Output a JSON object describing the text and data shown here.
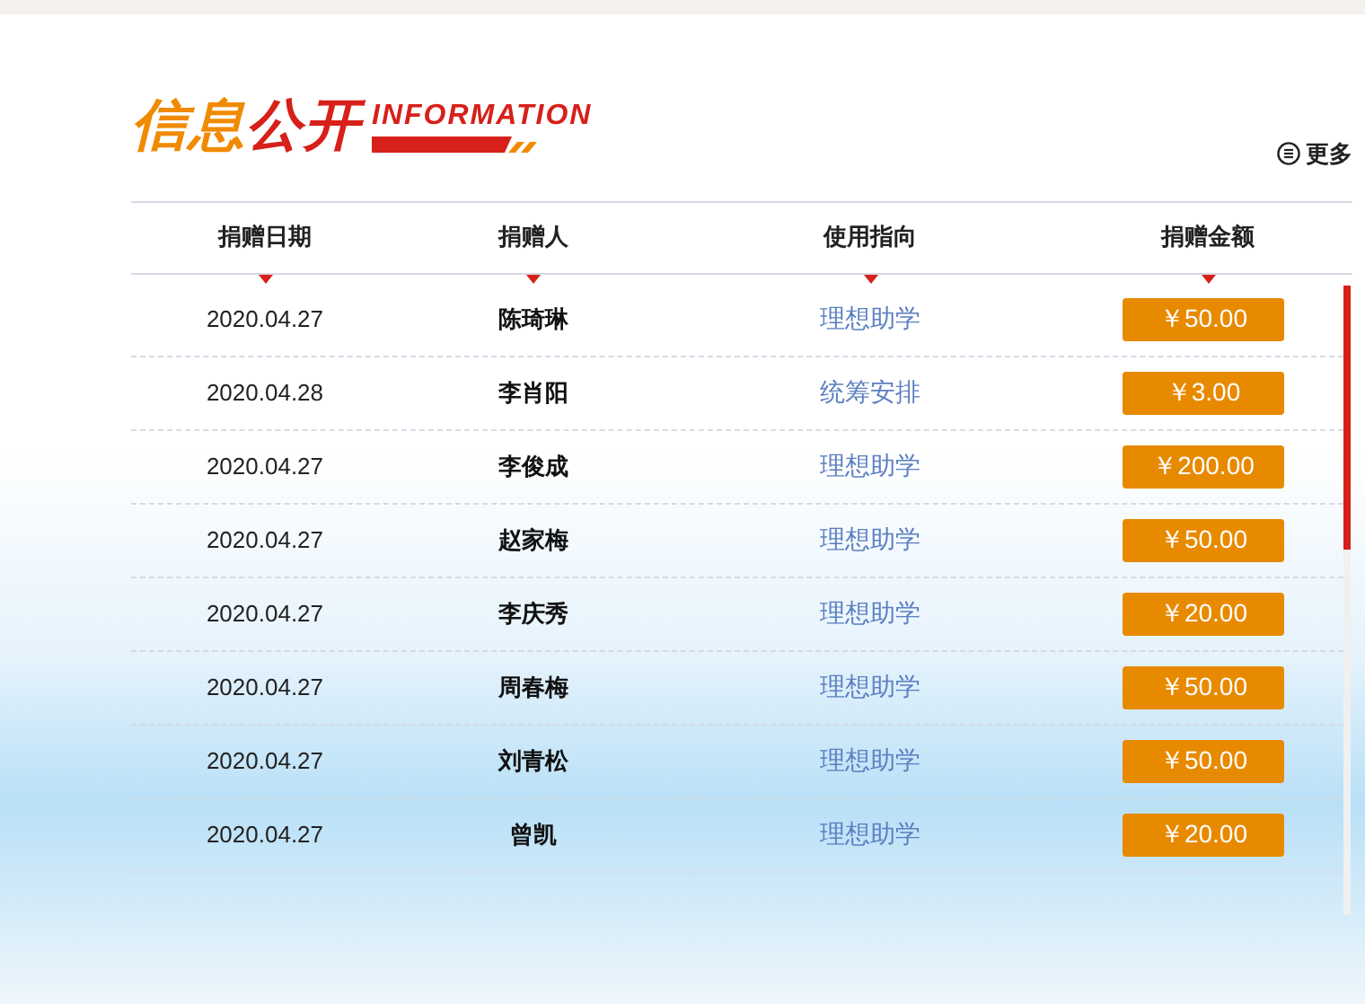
{
  "header": {
    "title_part1": "信息",
    "title_part2": "公开",
    "subtitle": "INFORMATION",
    "more": "更多"
  },
  "table": {
    "columns": [
      "捐赠日期",
      "捐赠人",
      "使用指向",
      "捐赠金额"
    ],
    "rows": [
      {
        "date": "2020.04.27",
        "donor": "陈琦琳",
        "purpose": "理想助学",
        "amount": "￥50.00"
      },
      {
        "date": "2020.04.28",
        "donor": "李肖阳",
        "purpose": "统筹安排",
        "amount": "￥3.00"
      },
      {
        "date": "2020.04.27",
        "donor": "李俊成",
        "purpose": "理想助学",
        "amount": "￥200.00"
      },
      {
        "date": "2020.04.27",
        "donor": "赵家梅",
        "purpose": "理想助学",
        "amount": "￥50.00"
      },
      {
        "date": "2020.04.27",
        "donor": "李庆秀",
        "purpose": "理想助学",
        "amount": "￥20.00"
      },
      {
        "date": "2020.04.27",
        "donor": "周春梅",
        "purpose": "理想助学",
        "amount": "￥50.00"
      },
      {
        "date": "2020.04.27",
        "donor": "刘青松",
        "purpose": "理想助学",
        "amount": "￥50.00"
      },
      {
        "date": "2020.04.27",
        "donor": "曾凯",
        "purpose": "理想助学",
        "amount": "￥20.00"
      }
    ]
  }
}
